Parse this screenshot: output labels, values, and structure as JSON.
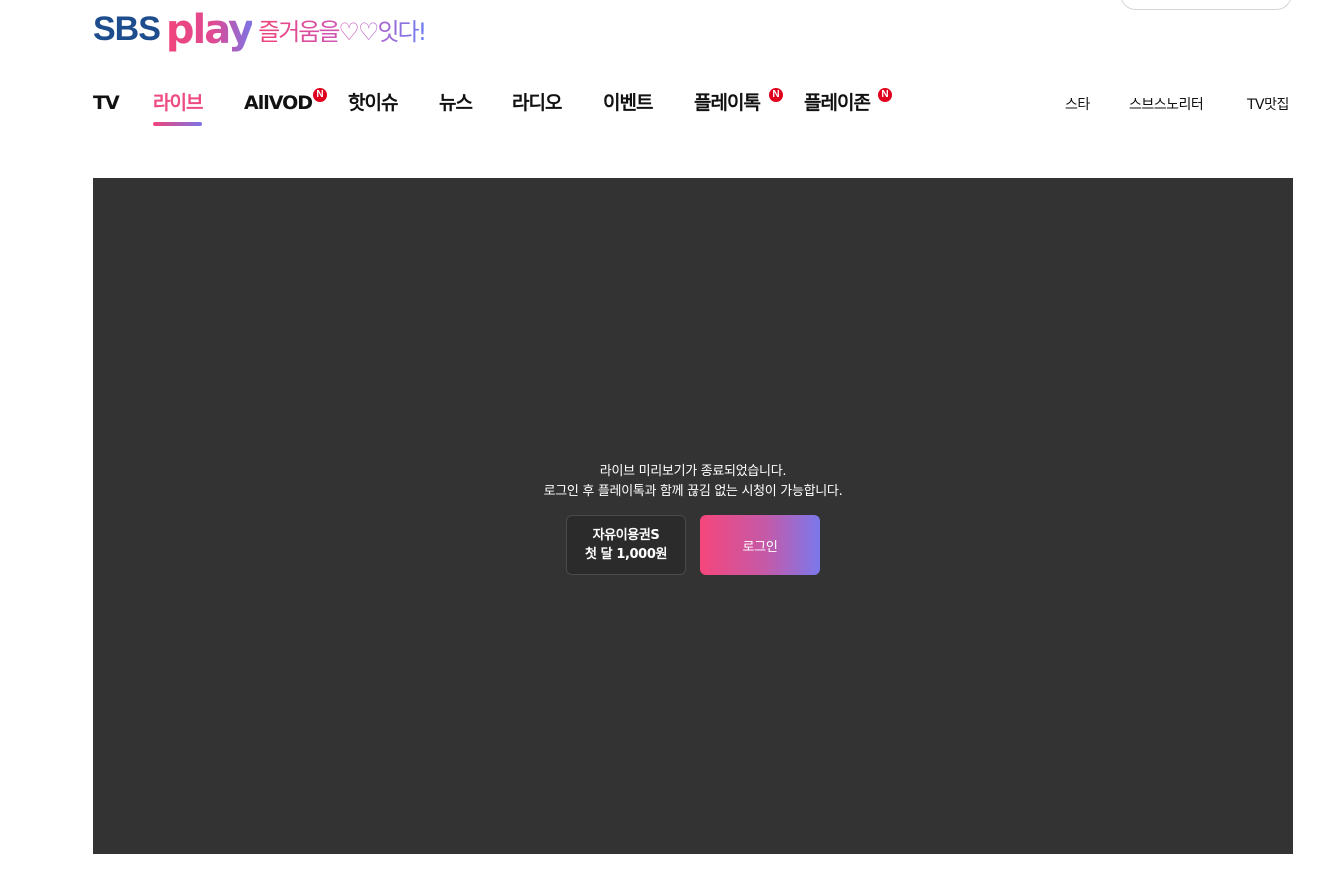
{
  "logo": {
    "sbs": "SBS",
    "play": "play",
    "slogan": "즐거움을♡♡잇다!"
  },
  "gnb": {
    "items": [
      {
        "label": "TV",
        "active": false,
        "new": false
      },
      {
        "label": "라이브",
        "active": true,
        "new": false
      },
      {
        "label": "AllVOD",
        "active": false,
        "new": true
      },
      {
        "label": "핫이슈",
        "active": false,
        "new": false
      },
      {
        "label": "뉴스",
        "active": false,
        "new": false
      },
      {
        "label": "라디오",
        "active": false,
        "new": false
      },
      {
        "label": "이벤트",
        "active": false,
        "new": false
      },
      {
        "label": "플레이톡",
        "active": false,
        "new": true
      },
      {
        "label": "플레이존",
        "active": false,
        "new": true
      }
    ],
    "badge": "N",
    "sub_items": [
      "스타",
      "스브스노리터",
      "TV맛집"
    ]
  },
  "player": {
    "notice_line1": "라이브 미리보기가 종료되었습니다.",
    "notice_line2": "로그인 후 플레이톡과 함께 끊김 없는 시청이 가능합니다.",
    "pass_button": {
      "line1": "자유이용권S",
      "line2": "첫 달 1,000원"
    },
    "login_button": "로그인"
  },
  "colors": {
    "brand_pink": "#ee4a83",
    "brand_purple": "#7b74e6",
    "sbs_blue": "#1d4d8c",
    "new_badge": "#e1001e",
    "player_bg": "#333333"
  }
}
